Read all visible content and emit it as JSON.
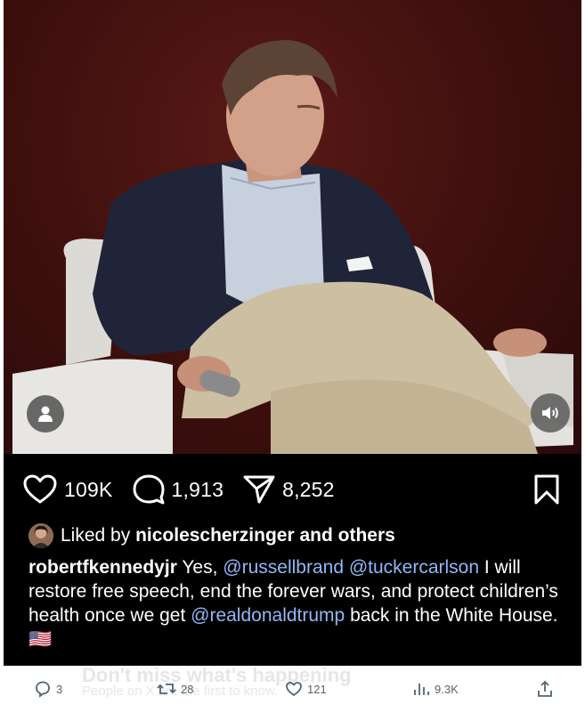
{
  "post": {
    "likes": "109K",
    "comments": "1,913",
    "shares": "8,252",
    "liked_by_prefix": "Liked by",
    "liked_by_user": "nicolescherzinger",
    "liked_by_suffix": "and others",
    "caption": {
      "author": "robertfkennedyjr",
      "text_1": "Yes,",
      "mention_1": "@russellbrand",
      "mention_2": "@tuckercarlson",
      "text_2": "I will restore free speech, end the forever wars, and protect children’s health once we get",
      "mention_3": "@realdonaldtrump",
      "text_3": "back in the White House.",
      "emoji": "🇺🇸"
    }
  },
  "x_bar": {
    "ghost_title": "Don't miss what's happening",
    "ghost_subtitle": "People on X are the first to know.",
    "replies": "3",
    "reposts": "28",
    "likes": "121",
    "views": "9.3K"
  },
  "icons": {
    "user_overlay": "user-icon",
    "sound": "speaker-icon",
    "like": "heart-icon",
    "comment": "comment-icon",
    "share": "send-icon",
    "save": "bookmark-icon",
    "reply": "reply-icon",
    "repost": "repost-icon",
    "views": "views-icon",
    "share_x": "share-icon"
  }
}
